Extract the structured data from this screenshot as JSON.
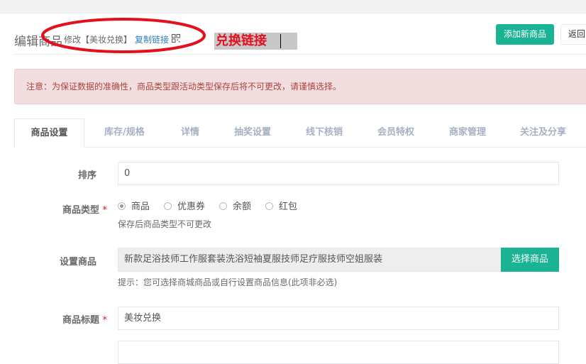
{
  "header": {
    "title": "编辑商品",
    "crumb": "修改【美妆兑换】",
    "copy_link": "复制链接",
    "add_button": "添加新商品",
    "back_button": "返回"
  },
  "annotation": {
    "text": "兑换链接",
    "color": "#e3101e"
  },
  "alert": {
    "text": "注意：为保证数据的准确性，商品类型跟活动类型保存后将不可更改，请谨慎选择。"
  },
  "tabs": [
    {
      "label": "商品设置",
      "active": true
    },
    {
      "label": "库存/规格"
    },
    {
      "label": "详情"
    },
    {
      "label": "抽奖设置"
    },
    {
      "label": "线下核销"
    },
    {
      "label": "会员特权"
    },
    {
      "label": "商家管理"
    },
    {
      "label": "关注及分享"
    }
  ],
  "form": {
    "sort_label": "排序",
    "sort_value": "0",
    "type_label": "商品类型",
    "required_mark": "*",
    "type_options": [
      "商品",
      "优惠券",
      "余额",
      "红包"
    ],
    "type_selected": "商品",
    "type_help": "保存后商品类型不可更改",
    "goods_label": "设置商品",
    "goods_value": "新款足浴技师工作服套装洗浴短袖夏服技师足疗服技师空姐服装",
    "select_goods_button": "选择商品",
    "goods_help": "提示：您可选择商城商品或自行设置商品信息(此项非必选)",
    "title_label": "商品标题",
    "title_value": "美妆兑换"
  },
  "colors": {
    "primary": "#1ab394",
    "alert_bg": "#f2dede",
    "alert_text": "#a94442",
    "link": "#2a7fc1"
  }
}
